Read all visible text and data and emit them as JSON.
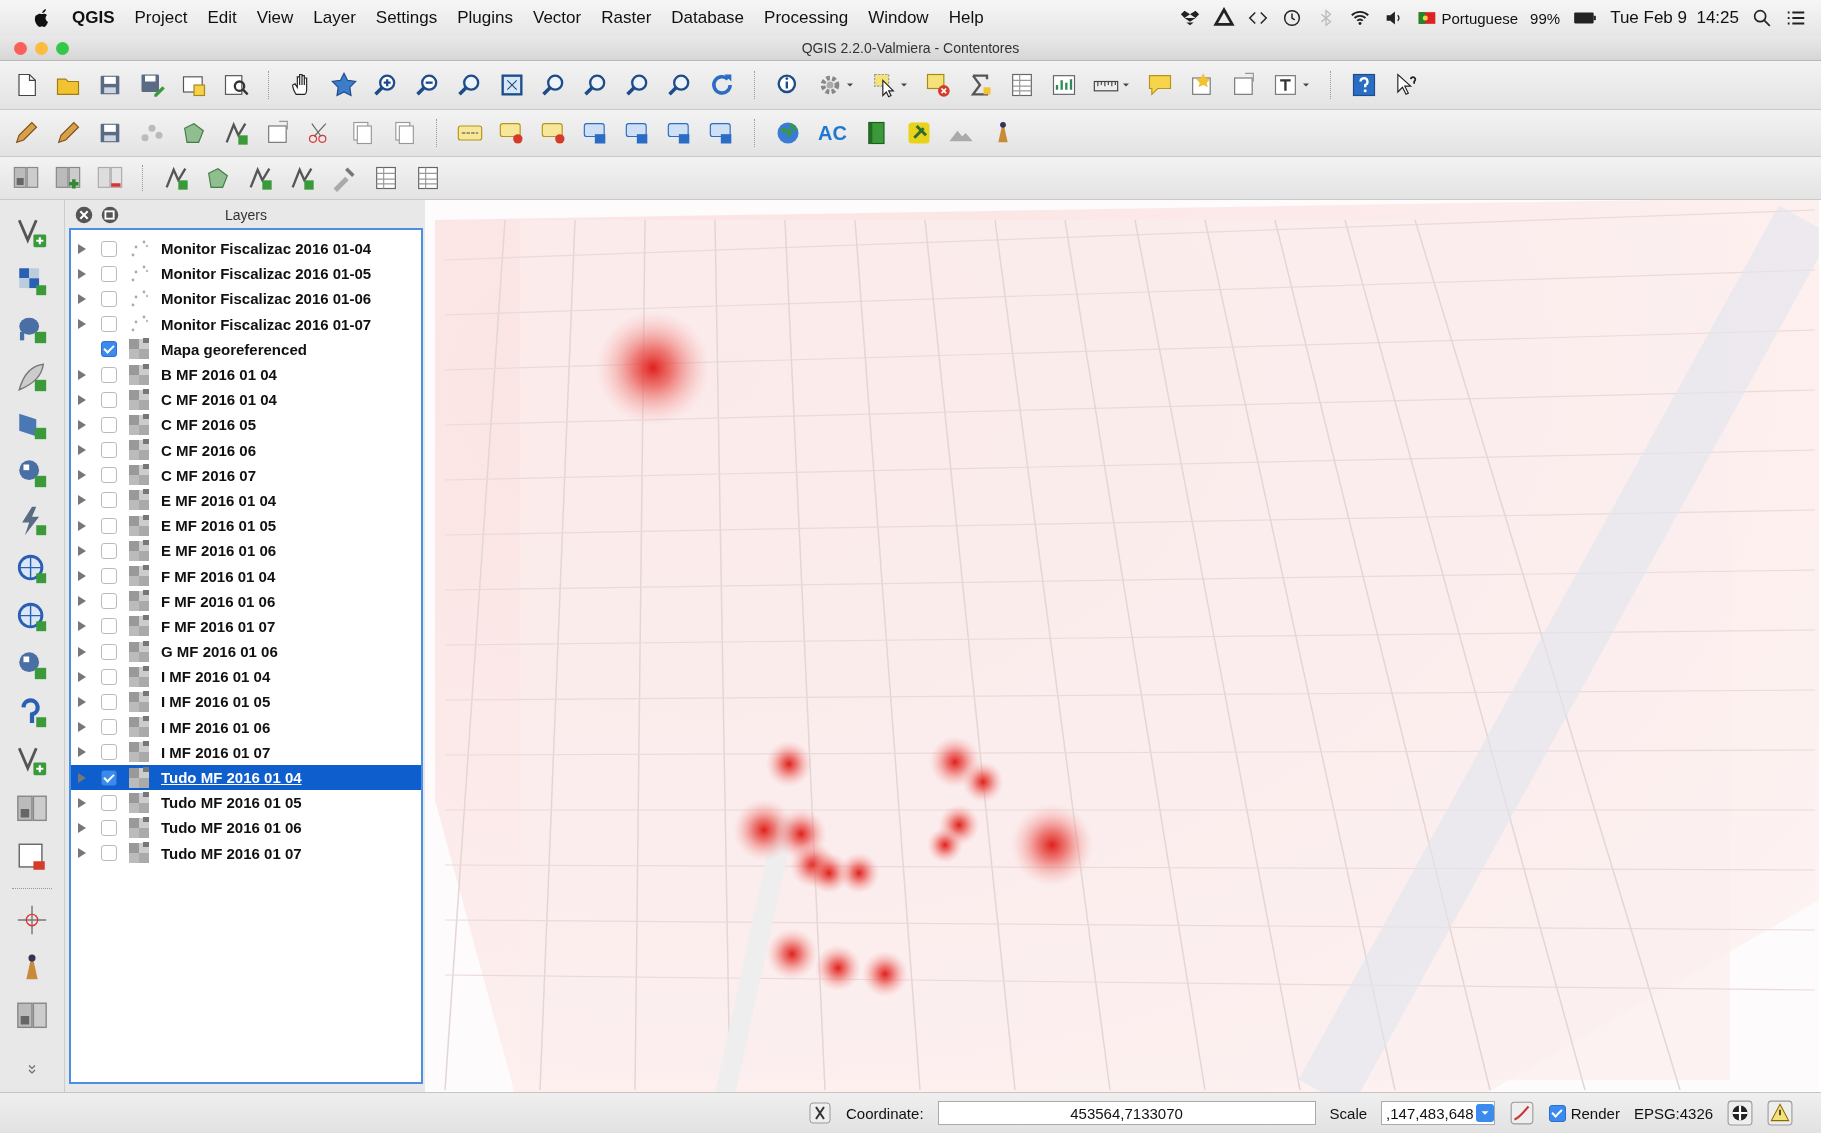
{
  "menu_bar": {
    "app": "QGIS",
    "menus": [
      "Project",
      "Edit",
      "View",
      "Layer",
      "Settings",
      "Plugins",
      "Vector",
      "Raster",
      "Database",
      "Processing",
      "Window",
      "Help"
    ],
    "language": "Portuguese",
    "battery": "99%",
    "clock": "Tue Feb 9  14:25"
  },
  "window": {
    "title": "QGIS 2.2.0-Valmiera - Contentores"
  },
  "label_toolbar": {
    "text_button": "AC"
  },
  "layers_panel": {
    "title": "Layers",
    "layers": [
      {
        "name": "Monitor Fiscalizac 2016 01-04",
        "kind": "point",
        "expandable": true,
        "checked": false,
        "selected": false
      },
      {
        "name": "Monitor Fiscalizac 2016 01-05",
        "kind": "point",
        "expandable": true,
        "checked": false,
        "selected": false
      },
      {
        "name": "Monitor Fiscalizac 2016 01-06",
        "kind": "point",
        "expandable": true,
        "checked": false,
        "selected": false
      },
      {
        "name": "Monitor Fiscalizac 2016 01-07",
        "kind": "point",
        "expandable": true,
        "checked": false,
        "selected": false
      },
      {
        "name": "Mapa georeferenced",
        "kind": "raster",
        "expandable": false,
        "checked": true,
        "selected": false
      },
      {
        "name": "B MF 2016 01 04",
        "kind": "raster",
        "expandable": true,
        "checked": false,
        "selected": false
      },
      {
        "name": "C MF 2016 01 04",
        "kind": "raster",
        "expandable": true,
        "checked": false,
        "selected": false
      },
      {
        "name": "C MF 2016 05",
        "kind": "raster",
        "expandable": true,
        "checked": false,
        "selected": false
      },
      {
        "name": "C MF 2016 06",
        "kind": "raster",
        "expandable": true,
        "checked": false,
        "selected": false
      },
      {
        "name": "C MF 2016 07",
        "kind": "raster",
        "expandable": true,
        "checked": false,
        "selected": false
      },
      {
        "name": "E MF 2016 01 04",
        "kind": "raster",
        "expandable": true,
        "checked": false,
        "selected": false
      },
      {
        "name": "E MF 2016 01 05",
        "kind": "raster",
        "expandable": true,
        "checked": false,
        "selected": false
      },
      {
        "name": "E MF 2016 01 06",
        "kind": "raster",
        "expandable": true,
        "checked": false,
        "selected": false
      },
      {
        "name": "F MF 2016 01 04",
        "kind": "raster",
        "expandable": true,
        "checked": false,
        "selected": false
      },
      {
        "name": "F MF 2016 01 06",
        "kind": "raster",
        "expandable": true,
        "checked": false,
        "selected": false
      },
      {
        "name": "F MF 2016 01 07",
        "kind": "raster",
        "expandable": true,
        "checked": false,
        "selected": false
      },
      {
        "name": "G MF 2016 01 06",
        "kind": "raster",
        "expandable": true,
        "checked": false,
        "selected": false
      },
      {
        "name": "I MF 2016 01 04",
        "kind": "raster",
        "expandable": true,
        "checked": false,
        "selected": false
      },
      {
        "name": "I MF 2016 01 05",
        "kind": "raster",
        "expandable": true,
        "checked": false,
        "selected": false
      },
      {
        "name": "I MF 2016 01 06",
        "kind": "raster",
        "expandable": true,
        "checked": false,
        "selected": false
      },
      {
        "name": "I MF 2016 01 07",
        "kind": "raster",
        "expandable": true,
        "checked": false,
        "selected": false
      },
      {
        "name": "Tudo MF 2016 01 04",
        "kind": "raster",
        "expandable": true,
        "checked": true,
        "selected": true
      },
      {
        "name": "Tudo MF 2016 01 05",
        "kind": "raster",
        "expandable": true,
        "checked": false,
        "selected": false
      },
      {
        "name": "Tudo MF 2016 01 06",
        "kind": "raster",
        "expandable": true,
        "checked": false,
        "selected": false
      },
      {
        "name": "Tudo MF 2016 01 07",
        "kind": "raster",
        "expandable": true,
        "checked": false,
        "selected": false
      }
    ]
  },
  "status_bar": {
    "coordinate_label": "Coordinate:",
    "coordinate_value": "453564,7133070",
    "scale_label": "Scale",
    "scale_value": ",147,483,648",
    "render_checked": true,
    "render_label": "Render",
    "crs": "EPSG:4326"
  }
}
